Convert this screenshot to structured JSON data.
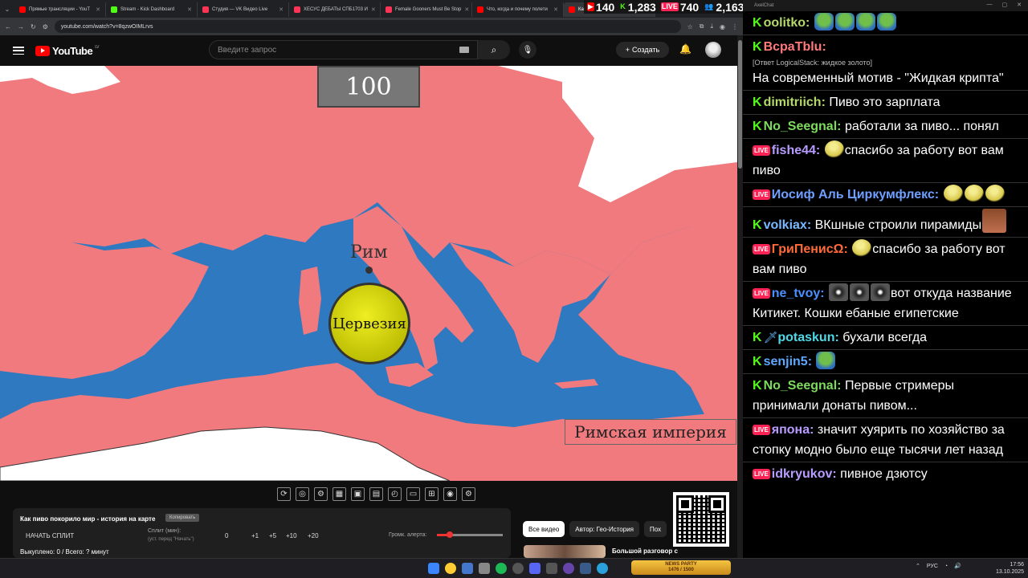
{
  "browser": {
    "tabs": [
      {
        "title": "Прямые трансляции - YouT",
        "color": "#ff0000",
        "active": false
      },
      {
        "title": "Stream - Kick Dashboard",
        "color": "#53fc18",
        "active": false
      },
      {
        "title": "Студия — VK Видео Live",
        "color": "#ff3355",
        "active": false
      },
      {
        "title": "ХЕСУС ДЕБАТЫ СПБ1703 И",
        "color": "#ff3355",
        "active": false
      },
      {
        "title": "Female Gooners Must Be Stop",
        "color": "#ff3355",
        "active": false
      },
      {
        "title": "Что, когда и почему полети",
        "color": "#ff0000",
        "active": false
      },
      {
        "title": "Как пи",
        "color": "#ff0000",
        "active": true
      }
    ],
    "url": "youtube.com/watch?v=8qzwOIMLrvs"
  },
  "viewer_stats": [
    {
      "platform": "youtube",
      "icon": "▶",
      "count": "140",
      "color": "#ff0000"
    },
    {
      "platform": "kick",
      "icon": "K",
      "count": "1,283",
      "color": "#53fc18"
    },
    {
      "platform": "vk",
      "icon": "LIVE",
      "count": "740",
      "color": "#ff2255"
    },
    {
      "platform": "total",
      "icon": "👥",
      "count": "2,163",
      "color": "#dddddd"
    }
  ],
  "youtube": {
    "logo": "YouTube",
    "region": "LV",
    "search_placeholder": "Введите запрос",
    "create_label": "Создать"
  },
  "video": {
    "year": "100",
    "city_label": "Рим",
    "ball_label": "Цервезия",
    "empire_label": "Римская империя",
    "colors": {
      "land": "#f07a7e",
      "sea": "#2f79c0",
      "unknown": "#ffffff"
    }
  },
  "split_panel": {
    "title": "Как пиво покорило мир - история на карте",
    "copy_label": "Копировать",
    "start_label": "НАЧАТЬ СПЛИТ",
    "split_label": "Сплит (мин):",
    "split_sub": "(уст. перед \"Начать\")",
    "split_value": "0",
    "increments": [
      "+1",
      "+5",
      "+10",
      "+20"
    ],
    "alert_label": "Громк. алерта:",
    "alert_volume": 0.2,
    "failed_text": "Выкуплено: 0 / Всего: ? минут"
  },
  "filters": [
    "Все видео",
    "Автор: Гео-История",
    "Пох"
  ],
  "related": {
    "title": "Большой разговор с"
  },
  "chat": {
    "window_title": "AxelChat",
    "messages": [
      {
        "platform": "k",
        "user": "oolitko",
        "color": "#b5d96a",
        "text": "",
        "emotes": [
          "pepe",
          "pepe",
          "pepe",
          "pepe"
        ]
      },
      {
        "platform": "k",
        "user": "BcpaTblu",
        "color": "#ff7a7a",
        "reply": "[Ответ LogicalStack: жидкое золото]",
        "text": "На современный мотив - \"Жидкая крипта\""
      },
      {
        "platform": "k",
        "user": "dimitriich",
        "color": "#b5d96a",
        "text": "Пиво это зарплата"
      },
      {
        "platform": "k",
        "user": "No_Seegnal",
        "color": "#7ddb5e",
        "text": "работали за пиво... понял"
      },
      {
        "platform": "v",
        "user": "fishe44",
        "color": "#b99cff",
        "text": "спасибо за работу вот вам пиво",
        "emotes": [
          "blob"
        ]
      },
      {
        "platform": "v",
        "user": "Иосиф Аль Циркумфлекс",
        "color": "#6fa0ff",
        "text": "",
        "emotes": [
          "blob",
          "blob",
          "blob"
        ]
      },
      {
        "platform": "k",
        "user": "volkiax",
        "color": "#7ab8ff",
        "text": "ВКшные строили пирамиды",
        "emotes": [
          "face"
        ]
      },
      {
        "platform": "v",
        "user": "ГриПенисΩ",
        "color": "#ff6a3a",
        "text": "спасибо за работу вот вам пиво",
        "emotes": [
          "blob"
        ]
      },
      {
        "platform": "v",
        "user": "ne_tvoy",
        "color": "#4a90ff",
        "text": "вот откуда название Китикет. Кошки ебаные египетские",
        "emotes": [
          "cat",
          "cat",
          "cat"
        ]
      },
      {
        "platform": "k",
        "user": "potaskun",
        "color": "#4fd9e8",
        "text": "бухали всегда",
        "badge": "🗡"
      },
      {
        "platform": "k",
        "user": "senjin5",
        "color": "#5fa8ff",
        "text": "",
        "emotes": [
          "pepe"
        ]
      },
      {
        "platform": "k",
        "user": "No_Seegnal",
        "color": "#7ddb5e",
        "text": "Первые стримеры принимали донаты пивом..."
      },
      {
        "platform": "v",
        "user": "япона",
        "color": "#b99cff",
        "text": "значит хуярить по хозяйство за стопку модно было еще тысячи лет назад"
      },
      {
        "platform": "v",
        "user": "idkryukov",
        "color": "#b99cff",
        "text": "пивное дзютсу"
      }
    ]
  },
  "taskbar": {
    "now_playing": "NEWS PARTY",
    "now_playing_sub": "1476 / 1500",
    "lang": "РУС",
    "time": "17:56",
    "date": "13.10.2025"
  }
}
